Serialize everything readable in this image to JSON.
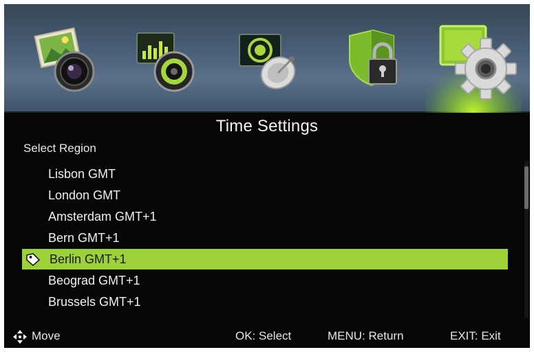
{
  "menu": {
    "tabs": [
      {
        "icon": "picture-camera-icon"
      },
      {
        "icon": "audio-speaker-icon"
      },
      {
        "icon": "satellite-dish-icon"
      },
      {
        "icon": "lock-shield-icon"
      },
      {
        "icon": "settings-gear-icon",
        "active": true
      }
    ]
  },
  "page": {
    "title": "Time Settings",
    "section_label": "Select Region"
  },
  "regions": [
    {
      "label": "Lisbon GMT",
      "selected": false
    },
    {
      "label": "London GMT",
      "selected": false
    },
    {
      "label": "Amsterdam GMT+1",
      "selected": false
    },
    {
      "label": "Bern GMT+1",
      "selected": false
    },
    {
      "label": "Berlin GMT+1",
      "selected": true
    },
    {
      "label": "Beograd GMT+1",
      "selected": false
    },
    {
      "label": "Brussels GMT+1",
      "selected": false
    }
  ],
  "scroll": {
    "position": 0.05
  },
  "help": {
    "move": "Move",
    "ok": "OK: Select",
    "menu": "MENU: Return",
    "exit": "EXIT: Exit"
  },
  "colors": {
    "highlight": "#9cd13a",
    "background": "#060606",
    "header": "#4a5f77",
    "accent_glow": "#c4ff28"
  }
}
